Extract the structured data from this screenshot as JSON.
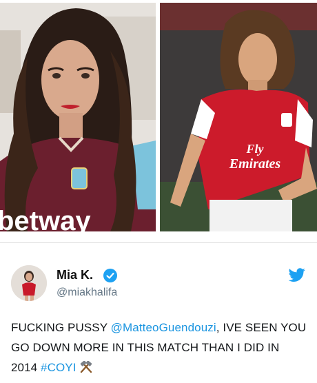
{
  "photos": {
    "left": {
      "shirt_sponsor": "betway"
    },
    "right": {
      "shirt_sponsor": "Fly Emirates"
    }
  },
  "tweet": {
    "display_name": "Mia K.",
    "handle": "@miakhalifa",
    "text_part1": "FUCKING PUSSY ",
    "mention": "@MatteoGuendouzi",
    "text_part2": ", IVE SEEN YOU GO DOWN MORE IN THIS MATCH THAN I DID IN 2014 ",
    "hashtag": "#COYI",
    "accent_color": "#1da1f2"
  }
}
